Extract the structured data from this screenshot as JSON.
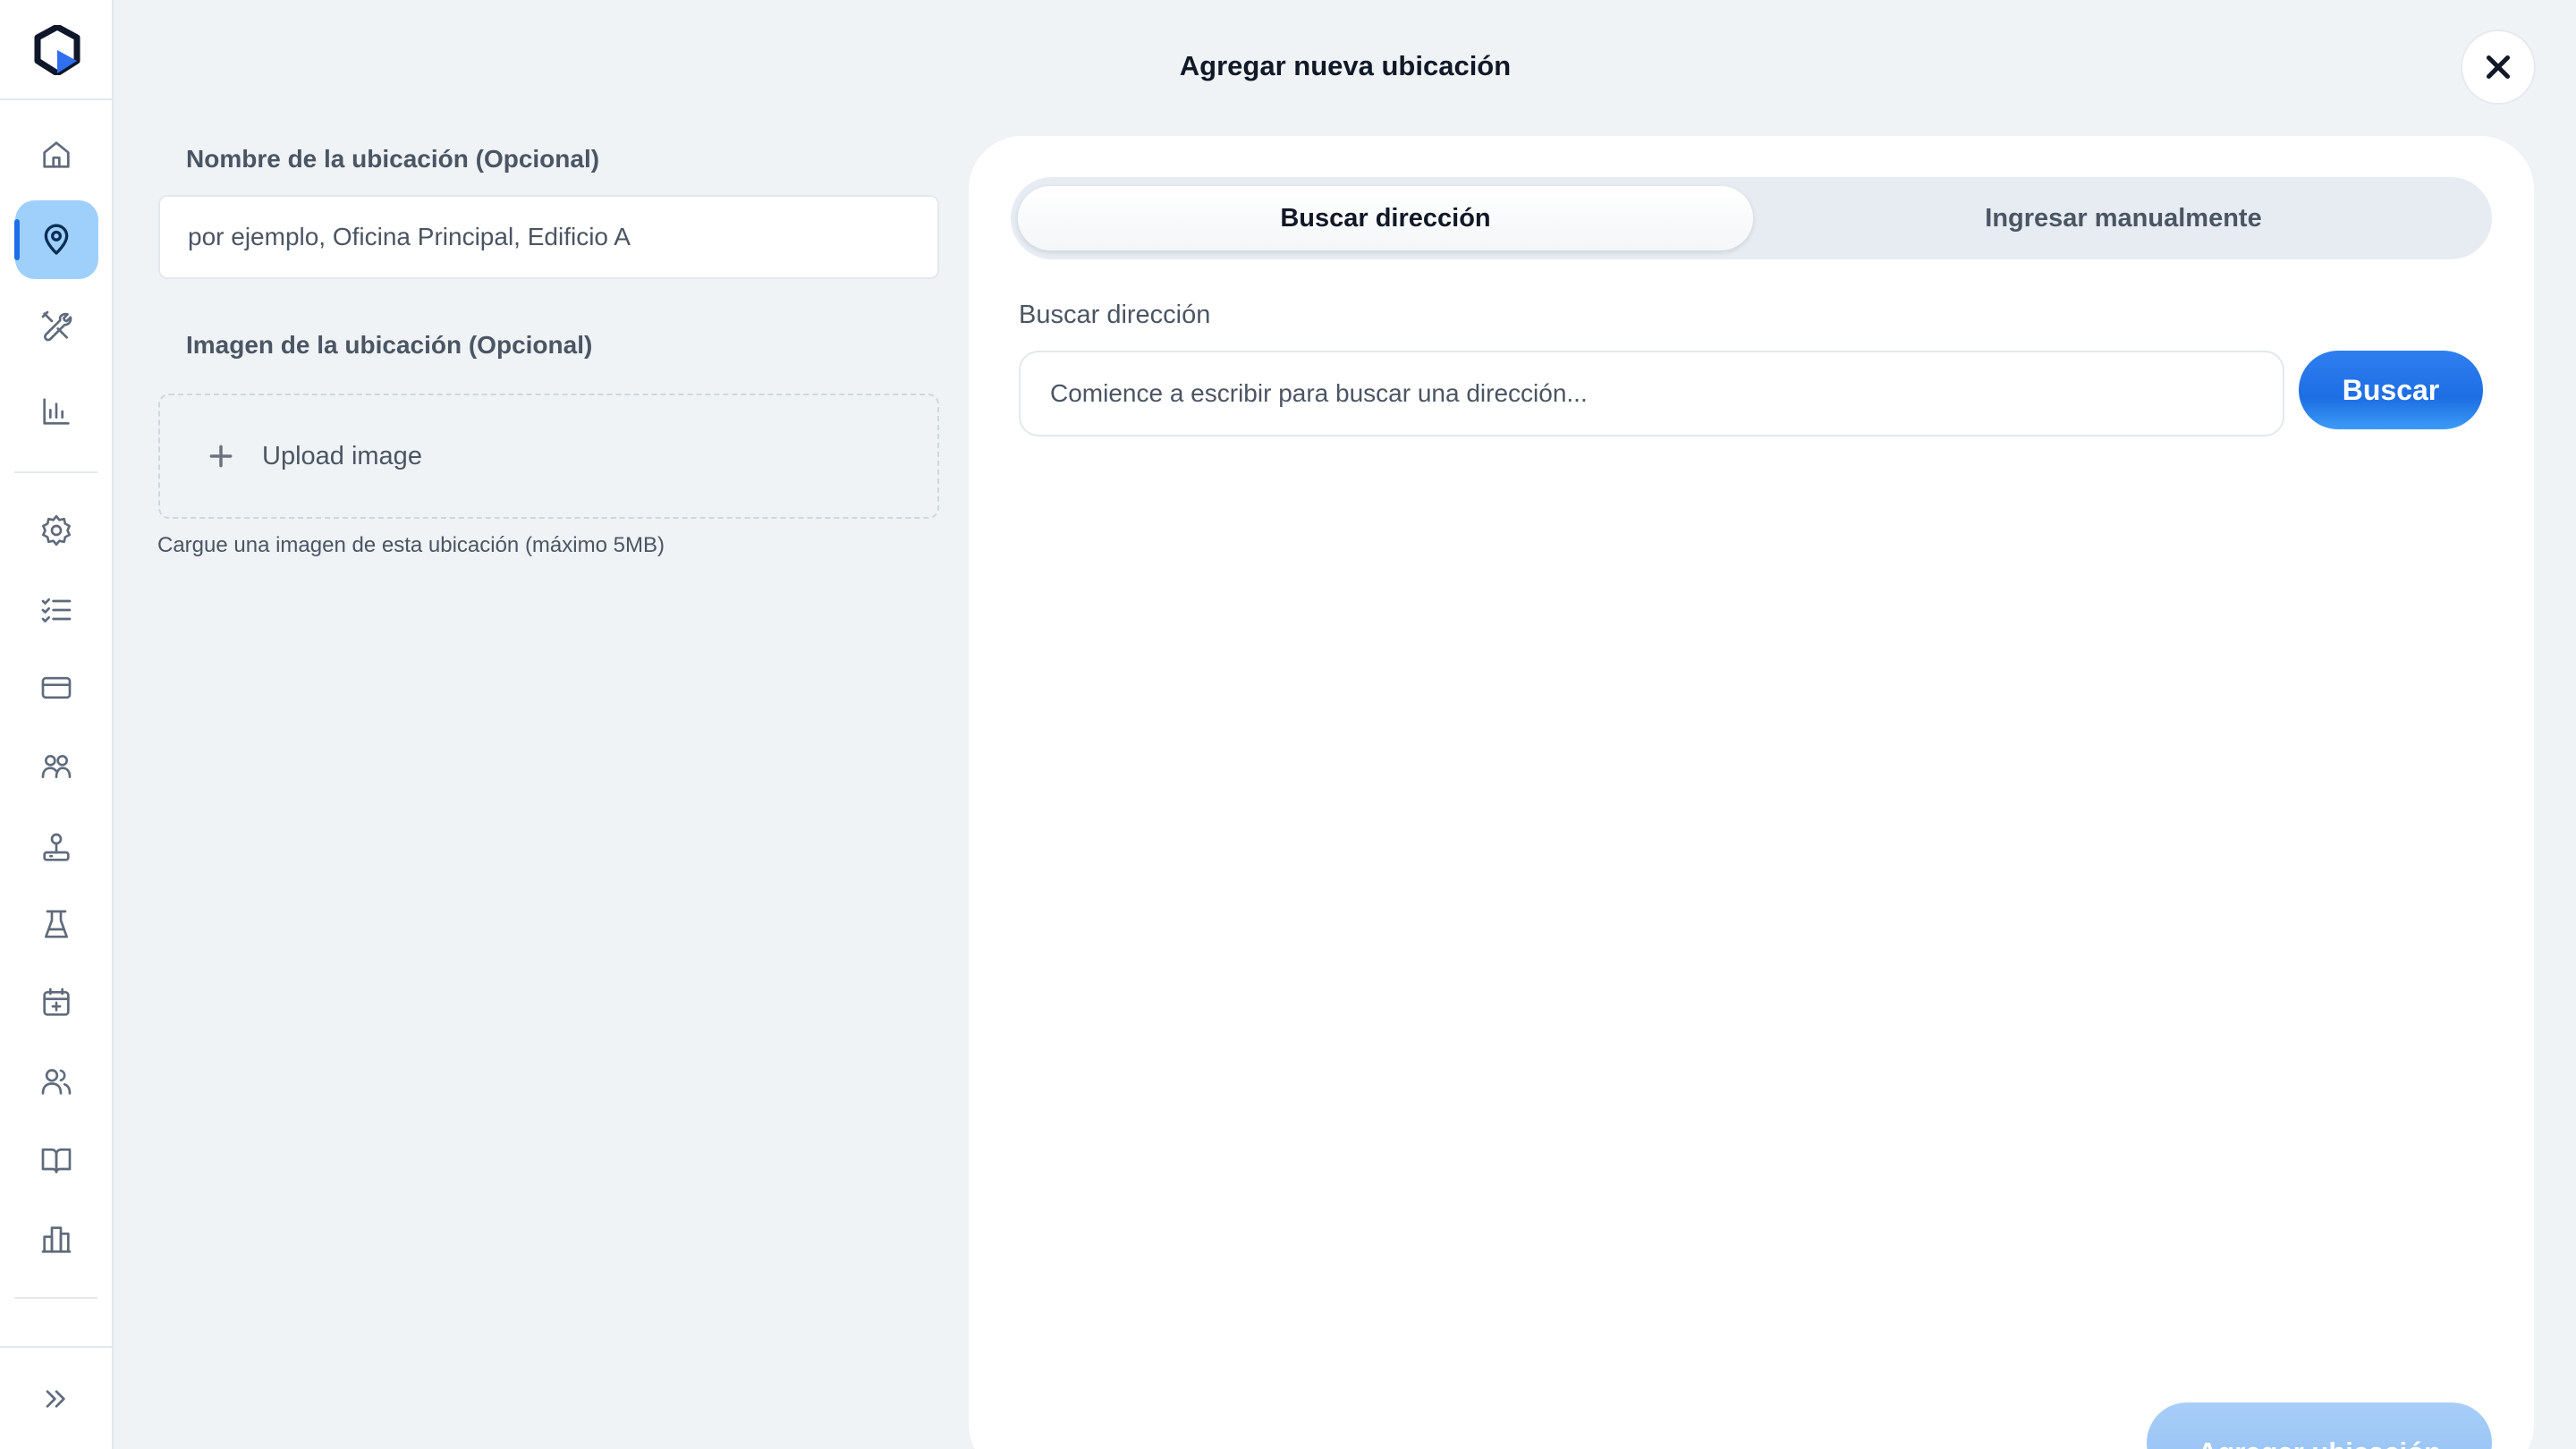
{
  "modal": {
    "title": "Agregar nueva ubicación"
  },
  "form": {
    "name_label": "Nombre de la ubicación (Opcional)",
    "name_placeholder": "por ejemplo, Oficina Principal, Edificio A",
    "name_value": "",
    "image_label": "Imagen de la ubicación (Opcional)",
    "upload_label": "Upload image",
    "upload_help": "Cargue una imagen de esta ubicación (máximo 5MB)"
  },
  "address": {
    "tabs": [
      {
        "label": "Buscar dirección",
        "active": true
      },
      {
        "label": "Ingresar manualmente",
        "active": false
      }
    ],
    "search_label": "Buscar dirección",
    "search_placeholder": "Comience a escribir para buscar una dirección...",
    "search_value": "",
    "search_button": "Buscar"
  },
  "footer": {
    "submit_label": "Agregar ubicación"
  },
  "sidebar": {
    "active_item": "locations",
    "items": [
      {
        "icon": "home-icon"
      },
      {
        "icon": "map-pin-icon"
      },
      {
        "icon": "tools-icon"
      },
      {
        "icon": "bar-chart-icon"
      },
      {
        "icon": "gear-icon"
      },
      {
        "icon": "checklist-icon"
      },
      {
        "icon": "credit-card-icon"
      },
      {
        "icon": "team-icon"
      },
      {
        "icon": "joystick-icon"
      },
      {
        "icon": "lab-flask-icon"
      },
      {
        "icon": "calendar-add-icon"
      },
      {
        "icon": "users-icon"
      },
      {
        "icon": "book-open-icon"
      },
      {
        "icon": "building-icon"
      },
      {
        "icon": "expand-chevrons-icon"
      }
    ]
  },
  "colors": {
    "accent": "#1d6fe8",
    "active_nav_bg": "#9fd0fb",
    "page_bg": "#eff3f6",
    "submit_disabled": "#a8cef8"
  }
}
